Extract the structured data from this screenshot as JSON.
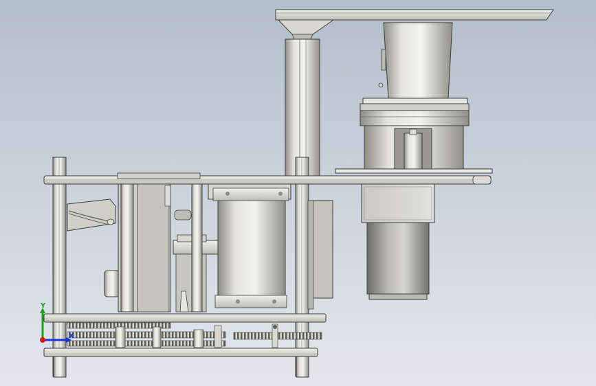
{
  "viewport": {
    "colors": {
      "background_top": "#b3becb",
      "background_bottom": "#e4e8ed",
      "metal_light": "#e9e9e4",
      "metal_mid": "#c8c8c0",
      "metal_dark": "#8e8e86",
      "outline": "#3c3c3c",
      "gear": "#5e5e5a"
    },
    "icons": [
      "coordinate-triad-icon"
    ]
  },
  "triad": {
    "y_label": "Y",
    "x_label": "X",
    "colors": {
      "x": "#1a35d6",
      "y": "#1ca51c",
      "z": "#d11a1a"
    }
  }
}
